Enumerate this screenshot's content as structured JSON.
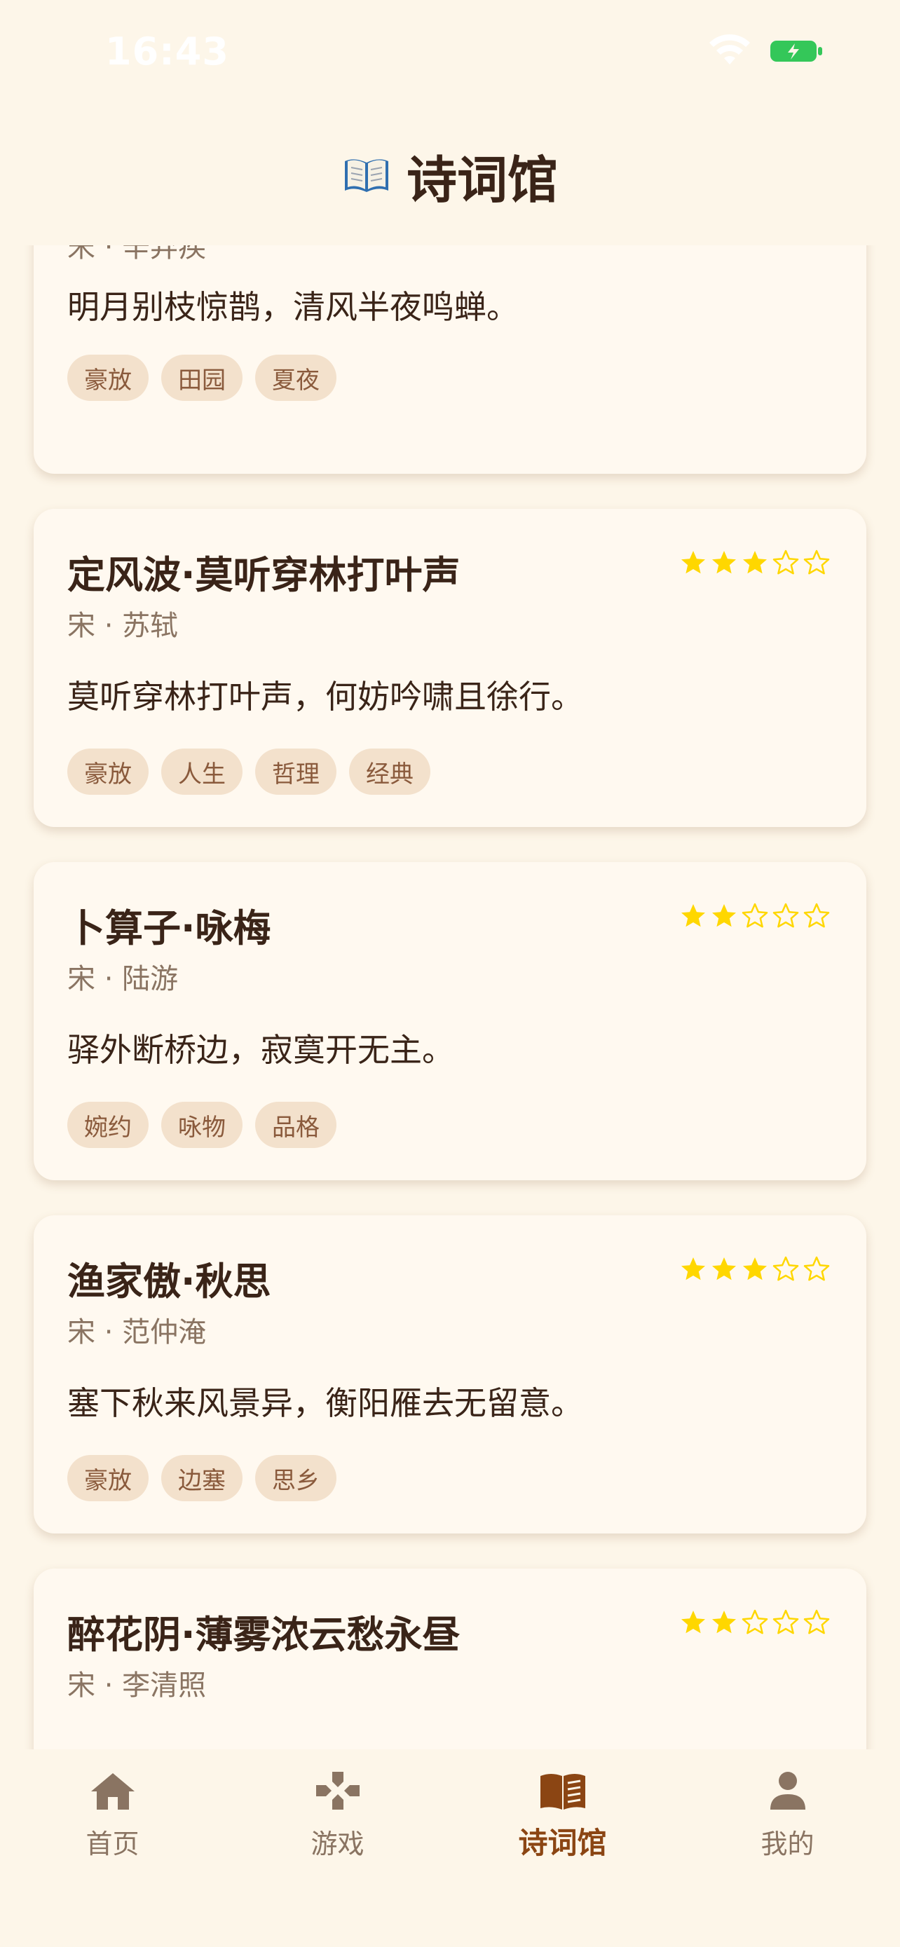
{
  "status_bar": {
    "time": "16:43"
  },
  "header": {
    "title": "诗词馆",
    "icon": "open-book-icon"
  },
  "colors": {
    "background": "#FDF6E9",
    "card": "#FFF9F0",
    "tag_bg": "#F3E1CC",
    "tag_text": "#8A5A3C",
    "star": "#FFD700",
    "active_tab": "#8B4513",
    "inactive_tab": "#8A7462",
    "battery": "#34C759"
  },
  "poems": [
    {
      "title": "",
      "author": "宋 · 辛弃疾",
      "line": "明月别枝惊鹊，清风半夜鸣蝉。",
      "tags": [
        "豪放",
        "田园",
        "夏夜"
      ]
    },
    {
      "title": "定风波·莫听穿林打叶声",
      "rating": 3,
      "author": "宋 · 苏轼",
      "line": "莫听穿林打叶声，何妨吟啸且徐行。",
      "tags": [
        "豪放",
        "人生",
        "哲理",
        "经典"
      ]
    },
    {
      "title": "卜算子·咏梅",
      "rating": 2,
      "author": "宋 · 陆游",
      "line": "驿外断桥边，寂寞开无主。",
      "tags": [
        "婉约",
        "咏物",
        "品格"
      ]
    },
    {
      "title": "渔家傲·秋思",
      "rating": 3,
      "author": "宋 · 范仲淹",
      "line": "塞下秋来风景异，衡阳雁去无留意。",
      "tags": [
        "豪放",
        "边塞",
        "思乡"
      ]
    },
    {
      "title": "醉花阴·薄雾浓云愁永昼",
      "rating": 2,
      "author": "宋 · 李清照",
      "line": "",
      "tags": []
    }
  ],
  "tabs": [
    {
      "label": "首页",
      "icon": "home-icon",
      "active": false
    },
    {
      "label": "游戏",
      "icon": "gamepad-icon",
      "active": false
    },
    {
      "label": "诗词馆",
      "icon": "book-icon",
      "active": true
    },
    {
      "label": "我的",
      "icon": "person-icon",
      "active": false
    }
  ]
}
